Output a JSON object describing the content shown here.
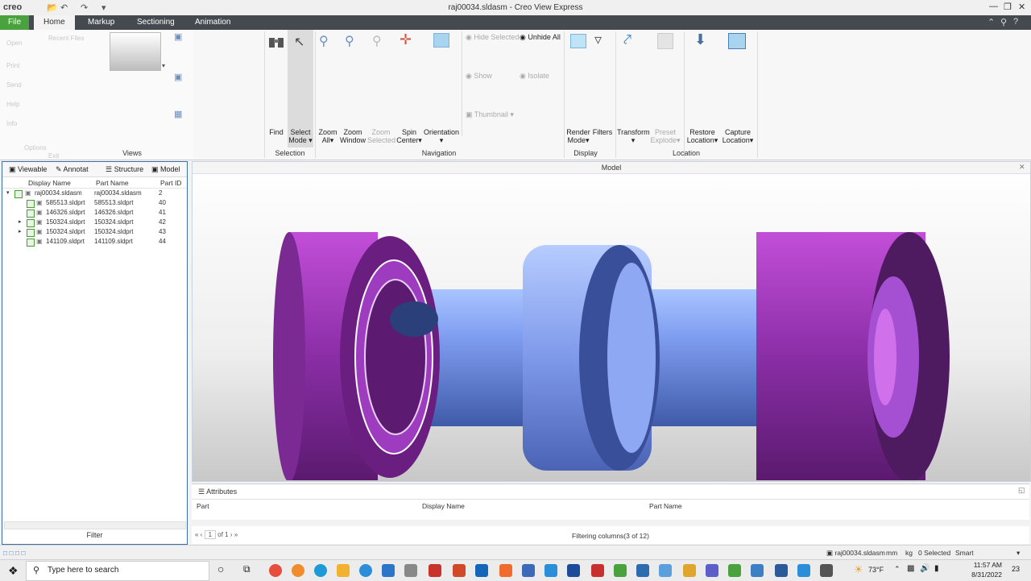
{
  "app": {
    "title": "raj00034.sldasm - Creo View Express",
    "logo": "creo"
  },
  "tabs": [
    "File",
    "Home",
    "Markup",
    "Sectioning",
    "Animation"
  ],
  "ribbon": {
    "views_label": "Views",
    "selection": {
      "label": "Selection",
      "find": "Find",
      "select_mode_1": "Select",
      "select_mode_2": "Mode"
    },
    "navigation": {
      "label": "Navigation",
      "zoom_all_1": "Zoom",
      "zoom_all_2": "All",
      "zoom_window_1": "Zoom",
      "zoom_window_2": "Window",
      "zoom_selected_1": "Zoom",
      "zoom_selected_2": "Selected",
      "spin_center_1": "Spin",
      "spin_center_2": "Center",
      "orientation": "Orientation",
      "hide_selected": "Hide Selected",
      "unhide_all": "Unhide All",
      "show": "Show",
      "isolate": "Isolate",
      "thumbnail": "Thumbnail"
    },
    "display": {
      "label": "Display",
      "render_mode_1": "Render",
      "render_mode_2": "Mode",
      "filters": "Filters"
    },
    "location": {
      "label": "Location",
      "transform": "Transform",
      "preset_explode_1": "Preset",
      "preset_explode_2": "Explode",
      "restore_location_1": "Restore",
      "restore_location_2": "Location",
      "capture_location_1": "Capture",
      "capture_location_2": "Location"
    }
  },
  "left_panel": {
    "tabs": [
      "Viewable",
      "Annotat",
      "Structure",
      "Model"
    ],
    "columns": [
      "Display Name",
      "Part Name",
      "Part ID"
    ],
    "rows": [
      {
        "display": "raj00034.sldasm",
        "part": "raj00034.sldasm",
        "id": "2"
      },
      {
        "display": "585513.sldprt",
        "part": "585513.sldprt",
        "id": "40"
      },
      {
        "display": "146326.sldprt",
        "part": "146326.sldprt",
        "id": "41"
      },
      {
        "display": "150324.sldprt",
        "part": "150324.sldprt",
        "id": "42"
      },
      {
        "display": "150324.sldprt",
        "part": "150324.sldprt",
        "id": "43"
      },
      {
        "display": "141109.sldprt",
        "part": "141109.sldprt",
        "id": "44"
      }
    ],
    "filter_label": "Filter"
  },
  "viewport": {
    "title": "Model"
  },
  "attributes": {
    "title": "Attributes",
    "columns": [
      "Part",
      "Display Name",
      "Part Name"
    ],
    "page": "1",
    "of_pages": "of 1",
    "filter_status": "Filtering columns(3 of 12)"
  },
  "status": {
    "file": "raj00034.sldasm",
    "units_length": "mm",
    "units_mass": "kg",
    "selected": "0 Selected",
    "mode": "Smart"
  },
  "taskbar": {
    "search_placeholder": "Type here to search",
    "weather": "73°F",
    "time": "11:57 AM",
    "date": "8/31/2022",
    "notifications": "23"
  },
  "file_menu_ghost": [
    "Recent Files",
    "Open",
    "Print",
    "Send",
    "Help",
    "Info",
    "Options",
    "Exit"
  ]
}
